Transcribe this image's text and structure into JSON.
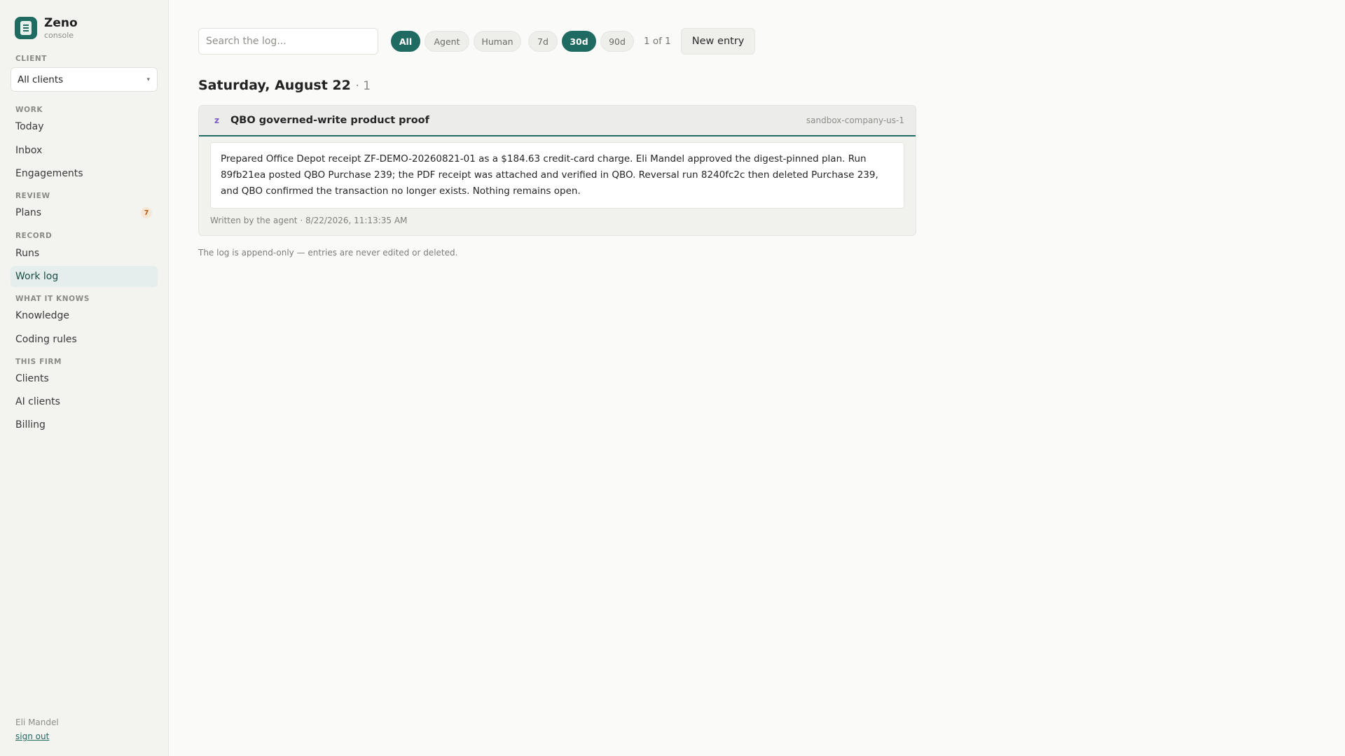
{
  "brand": {
    "name": "Zeno",
    "subtitle": "console"
  },
  "sidebar": {
    "client_label": "CLIENT",
    "client_selected": "All clients",
    "sections": [
      {
        "label": "WORK",
        "items": [
          {
            "label": "Today"
          },
          {
            "label": "Inbox"
          },
          {
            "label": "Engagements"
          }
        ]
      },
      {
        "label": "REVIEW",
        "items": [
          {
            "label": "Plans",
            "badge": "7"
          }
        ]
      },
      {
        "label": "RECORD",
        "items": [
          {
            "label": "Runs"
          },
          {
            "label": "Work log",
            "active": true
          }
        ]
      },
      {
        "label": "WHAT IT KNOWS",
        "items": [
          {
            "label": "Knowledge"
          },
          {
            "label": "Coding rules"
          }
        ]
      },
      {
        "label": "THIS FIRM",
        "items": [
          {
            "label": "Clients"
          },
          {
            "label": "AI clients"
          },
          {
            "label": "Billing"
          }
        ]
      }
    ],
    "user": {
      "name": "Eli Mandel",
      "sign_out": "sign out"
    }
  },
  "toolbar": {
    "search_placeholder": "Search the log...",
    "filters": [
      {
        "label": "All",
        "active": true
      },
      {
        "label": "Agent"
      },
      {
        "label": "Human"
      }
    ],
    "ranges": [
      {
        "label": "7d"
      },
      {
        "label": "30d",
        "active": true
      },
      {
        "label": "90d"
      }
    ],
    "page_indicator": "1 of 1",
    "new_entry": "New entry"
  },
  "log": {
    "day_heading": "Saturday, August 22",
    "day_count": "· 1",
    "entries": [
      {
        "author_mark": "z",
        "title": "QBO governed-write product proof",
        "company": "sandbox-company-us-1",
        "body": "Prepared Office Depot receipt ZF-DEMO-20260821-01 as a $184.63 credit-card charge. Eli Mandel approved the digest-pinned plan. Run 89fb21ea posted QBO Purchase 239; the PDF receipt was attached and verified in QBO. Reversal run 8240fc2c then deleted Purchase 239, and QBO confirmed the transaction no longer exists. Nothing remains open.",
        "footer": "Written by the agent · 8/22/2026, 11:13:35 AM"
      }
    ],
    "append_note": "The log is append-only — entries are never edited or deleted."
  },
  "colors": {
    "accent": "#1f6b61",
    "active_bg": "#e5eeec",
    "badge_bg": "#f6e6d6",
    "badge_fg": "#b15b17"
  },
  "icons": {
    "logo": "notebook-icon",
    "select_caret": "chevron-down-icon"
  }
}
